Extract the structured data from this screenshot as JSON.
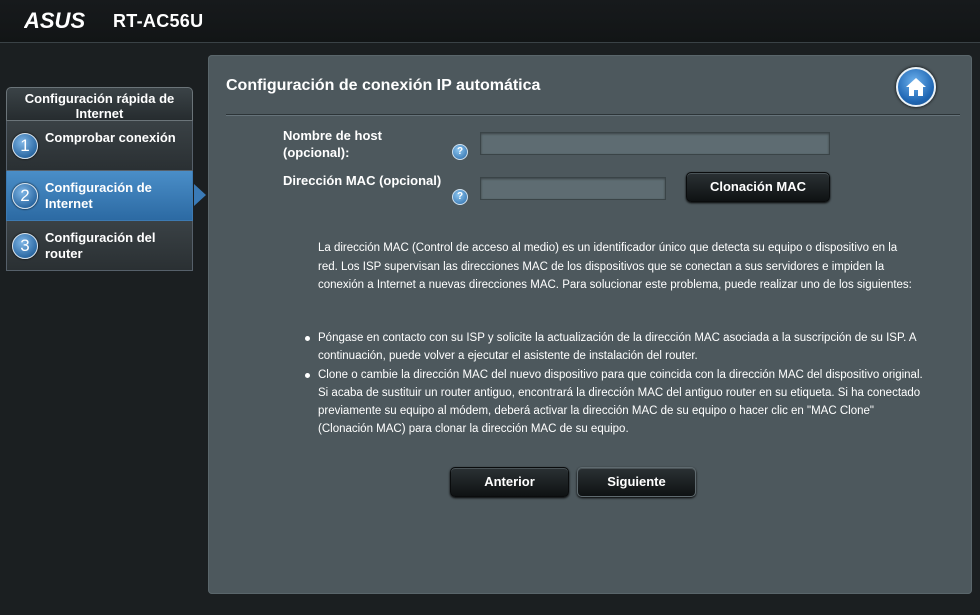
{
  "header": {
    "brand": "ASUS",
    "model": "RT-AC56U"
  },
  "sidebar": {
    "title": "Configuración rápida de Internet",
    "items": [
      {
        "number": "1",
        "label": "Comprobar conexión",
        "active": false
      },
      {
        "number": "2",
        "label": "Configuración de Internet",
        "active": true
      },
      {
        "number": "3",
        "label": "Configuración del router",
        "active": false
      }
    ]
  },
  "main": {
    "title": "Configuración de conexión IP automática",
    "home_icon": "home-icon",
    "hostname": {
      "label_line1": "Nombre de host",
      "label_line2": "(opcional):",
      "value": "",
      "help": "?"
    },
    "mac": {
      "label": "Dirección MAC (opcional)",
      "value": "",
      "help": "?",
      "clone_button": "Clonación MAC"
    },
    "description": "La dirección MAC (Control de acceso al medio) es un identificador único que detecta su equipo o dispositivo en la red. Los ISP supervisan las direcciones MAC de los dispositivos que se conectan a sus servidores e impiden la conexión a Internet a nuevas direcciones MAC. Para solucionar este problema, puede realizar uno de los siguientes:",
    "bullets": [
      "Póngase en contacto con su ISP y solicite la actualización de la dirección MAC asociada a la suscripción de su ISP. A continuación, puede volver a ejecutar el asistente de instalación del router.",
      "Clone o cambie la dirección MAC del nuevo dispositivo para que coincida con la dirección MAC del dispositivo original. Si acaba de sustituir un router antiguo, encontrará la dirección MAC del antiguo router en su etiqueta. Si ha conectado previamente su equipo al módem, deberá activar la dirección MAC de su equipo o hacer clic en \"MAC Clone\" (Clonación MAC) para clonar la dirección MAC de su equipo."
    ],
    "prev_button": "Anterior",
    "next_button": "Siguiente"
  },
  "colors": {
    "panel_bg": "#4d585d",
    "page_bg": "#1b1f21",
    "active_step": "#3a7ab6"
  }
}
